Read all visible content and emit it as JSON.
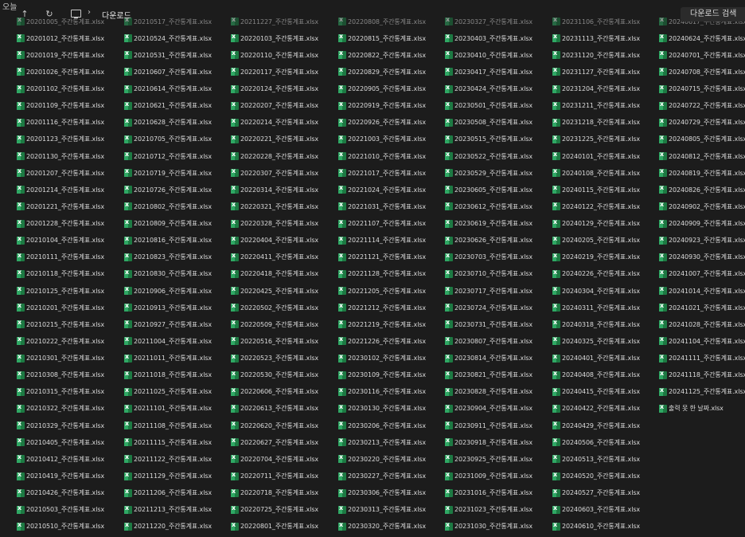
{
  "toolbar": {
    "group_label": "오늘",
    "up_icon": "arrow-up-icon",
    "refresh_icon": "refresh-icon",
    "breadcrumb_sep": "›",
    "breadcrumb": "다운로드",
    "search_placeholder": "다운로드 검색"
  },
  "columns": [
    [
      "20201005_주간통계표.xlsx",
      "20201012_주간통계표.xlsx",
      "20201019_주간통계표.xlsx",
      "20201026_주간통계표.xlsx",
      "20201102_주간통계표.xlsx",
      "20201109_주간통계표.xlsx",
      "20201116_주간통계표.xlsx",
      "20201123_주간통계표.xlsx",
      "20201130_주간통계표.xlsx",
      "20201207_주간통계표.xlsx",
      "20201214_주간통계표.xlsx",
      "20201221_주간통계표.xlsx",
      "20201228_주간통계표.xlsx",
      "20210104_주간통계표.xlsx",
      "20210111_주간통계표.xlsx",
      "20210118_주간통계표.xlsx",
      "20210125_주간통계표.xlsx",
      "20210201_주간통계표.xlsx",
      "20210215_주간통계표.xlsx",
      "20210222_주간통계표.xlsx",
      "20210301_주간통계표.xlsx",
      "20210308_주간통계표.xlsx",
      "20210315_주간통계표.xlsx",
      "20210322_주간통계표.xlsx",
      "20210329_주간통계표.xlsx",
      "20210405_주간통계표.xlsx",
      "20210412_주간통계표.xlsx",
      "20210419_주간통계표.xlsx",
      "20210426_주간통계표.xlsx",
      "20210503_주간통계표.xlsx",
      "20210510_주간통계표.xlsx"
    ],
    [
      "20210517_주간통계표.xlsx",
      "20210524_주간통계표.xlsx",
      "20210531_주간통계표.xlsx",
      "20210607_주간통계표.xlsx",
      "20210614_주간통계표.xlsx",
      "20210621_주간통계표.xlsx",
      "20210628_주간통계표.xlsx",
      "20210705_주간통계표.xlsx",
      "20210712_주간통계표.xlsx",
      "20210719_주간통계표.xlsx",
      "20210726_주간통계표.xlsx",
      "20210802_주간통계표.xlsx",
      "20210809_주간통계표.xlsx",
      "20210816_주간통계표.xlsx",
      "20210823_주간통계표.xlsx",
      "20210830_주간통계표.xlsx",
      "20210906_주간통계표.xlsx",
      "20210913_주간통계표.xlsx",
      "20210927_주간통계표.xlsx",
      "20211004_주간통계표.xlsx",
      "20211011_주간통계표.xlsx",
      "20211018_주간통계표.xlsx",
      "20211025_주간통계표.xlsx",
      "20211101_주간통계표.xlsx",
      "20211108_주간통계표.xlsx",
      "20211115_주간통계표.xlsx",
      "20211122_주간통계표.xlsx",
      "20211129_주간통계표.xlsx",
      "20211206_주간통계표.xlsx",
      "20211213_주간통계표.xlsx",
      "20211220_주간통계표.xlsx"
    ],
    [
      "20211227_주간통계표.xlsx",
      "20220103_주간통계표.xlsx",
      "20220110_주간통계표.xlsx",
      "20220117_주간통계표.xlsx",
      "20220124_주간통계표.xlsx",
      "20220207_주간통계표.xlsx",
      "20220214_주간통계표.xlsx",
      "20220221_주간통계표.xlsx",
      "20220228_주간통계표.xlsx",
      "20220307_주간통계표.xlsx",
      "20220314_주간통계표.xlsx",
      "20220321_주간통계표.xlsx",
      "20220328_주간통계표.xlsx",
      "20220404_주간통계표.xlsx",
      "20220411_주간통계표.xlsx",
      "20220418_주간통계표.xlsx",
      "20220425_주간통계표.xlsx",
      "20220502_주간통계표.xlsx",
      "20220509_주간통계표.xlsx",
      "20220516_주간통계표.xlsx",
      "20220523_주간통계표.xlsx",
      "20220530_주간통계표.xlsx",
      "20220606_주간통계표.xlsx",
      "20220613_주간통계표.xlsx",
      "20220620_주간통계표.xlsx",
      "20220627_주간통계표.xlsx",
      "20220704_주간통계표.xlsx",
      "20220711_주간통계표.xlsx",
      "20220718_주간통계표.xlsx",
      "20220725_주간통계표.xlsx",
      "20220801_주간통계표.xlsx"
    ],
    [
      "20220808_주간통계표.xlsx",
      "20220815_주간통계표.xlsx",
      "20220822_주간통계표.xlsx",
      "20220829_주간통계표.xlsx",
      "20220905_주간통계표.xlsx",
      "20220919_주간통계표.xlsx",
      "20220926_주간통계표.xlsx",
      "20221003_주간통계표.xlsx",
      "20221010_주간통계표.xlsx",
      "20221017_주간통계표.xlsx",
      "20221024_주간통계표.xlsx",
      "20221031_주간통계표.xlsx",
      "20221107_주간통계표.xlsx",
      "20221114_주간통계표.xlsx",
      "20221121_주간통계표.xlsx",
      "20221128_주간통계표.xlsx",
      "20221205_주간통계표.xlsx",
      "20221212_주간통계표.xlsx",
      "20221219_주간통계표.xlsx",
      "20221226_주간통계표.xlsx",
      "20230102_주간통계표.xlsx",
      "20230109_주간통계표.xlsx",
      "20230116_주간통계표.xlsx",
      "20230130_주간통계표.xlsx",
      "20230206_주간통계표.xlsx",
      "20230213_주간통계표.xlsx",
      "20230220_주간통계표.xlsx",
      "20230227_주간통계표.xlsx",
      "20230306_주간통계표.xlsx",
      "20230313_주간통계표.xlsx",
      "20230320_주간통계표.xlsx"
    ],
    [
      "20230327_주간통계표.xlsx",
      "20230403_주간통계표.xlsx",
      "20230410_주간통계표.xlsx",
      "20230417_주간통계표.xlsx",
      "20230424_주간통계표.xlsx",
      "20230501_주간통계표.xlsx",
      "20230508_주간통계표.xlsx",
      "20230515_주간통계표.xlsx",
      "20230522_주간통계표.xlsx",
      "20230529_주간통계표.xlsx",
      "20230605_주간통계표.xlsx",
      "20230612_주간통계표.xlsx",
      "20230619_주간통계표.xlsx",
      "20230626_주간통계표.xlsx",
      "20230703_주간통계표.xlsx",
      "20230710_주간통계표.xlsx",
      "20230717_주간통계표.xlsx",
      "20230724_주간통계표.xlsx",
      "20230731_주간통계표.xlsx",
      "20230807_주간통계표.xlsx",
      "20230814_주간통계표.xlsx",
      "20230821_주간통계표.xlsx",
      "20230828_주간통계표.xlsx",
      "20230904_주간통계표.xlsx",
      "20230911_주간통계표.xlsx",
      "20230918_주간통계표.xlsx",
      "20230925_주간통계표.xlsx",
      "20231009_주간통계표.xlsx",
      "20231016_주간통계표.xlsx",
      "20231023_주간통계표.xlsx",
      "20231030_주간통계표.xlsx"
    ],
    [
      "20231106_주간통계표.xlsx",
      "20231113_주간통계표.xlsx",
      "20231120_주간통계표.xlsx",
      "20231127_주간통계표.xlsx",
      "20231204_주간통계표.xlsx",
      "20231211_주간통계표.xlsx",
      "20231218_주간통계표.xlsx",
      "20231225_주간통계표.xlsx",
      "20240101_주간통계표.xlsx",
      "20240108_주간통계표.xlsx",
      "20240115_주간통계표.xlsx",
      "20240122_주간통계표.xlsx",
      "20240129_주간통계표.xlsx",
      "20240205_주간통계표.xlsx",
      "20240219_주간통계표.xlsx",
      "20240226_주간통계표.xlsx",
      "20240304_주간통계표.xlsx",
      "20240311_주간통계표.xlsx",
      "20240318_주간통계표.xlsx",
      "20240325_주간통계표.xlsx",
      "20240401_주간통계표.xlsx",
      "20240408_주간통계표.xlsx",
      "20240415_주간통계표.xlsx",
      "20240422_주간통계표.xlsx",
      "20240429_주간통계표.xlsx",
      "20240506_주간통계표.xlsx",
      "20240513_주간통계표.xlsx",
      "20240520_주간통계표.xlsx",
      "20240527_주간통계표.xlsx",
      "20240603_주간통계표.xlsx",
      "20240610_주간통계표.xlsx"
    ],
    [
      "20240617_주간통계표.xlsx",
      "20240624_주간통계표.xlsx",
      "20240701_주간통계표.xlsx",
      "20240708_주간통계표.xlsx",
      "20240715_주간통계표.xlsx",
      "20240722_주간통계표.xlsx",
      "20240729_주간통계표.xlsx",
      "20240805_주간통계표.xlsx",
      "20240812_주간통계표.xlsx",
      "20240819_주간통계표.xlsx",
      "20240826_주간통계표.xlsx",
      "20240902_주간통계표.xlsx",
      "20240909_주간통계표.xlsx",
      "20240923_주간통계표.xlsx",
      "20240930_주간통계표.xlsx",
      "20241007_주간통계표.xlsx",
      "20241014_주간통계표.xlsx",
      "20241021_주간통계표.xlsx",
      "20241028_주간통계표.xlsx",
      "20241104_주간통계표.xlsx",
      "20241111_주간통계표.xlsx",
      "20241118_주간통계표.xlsx",
      "20241125_주간통계표.xlsx",
      "출력 못 한 날짜.xlsx"
    ]
  ]
}
